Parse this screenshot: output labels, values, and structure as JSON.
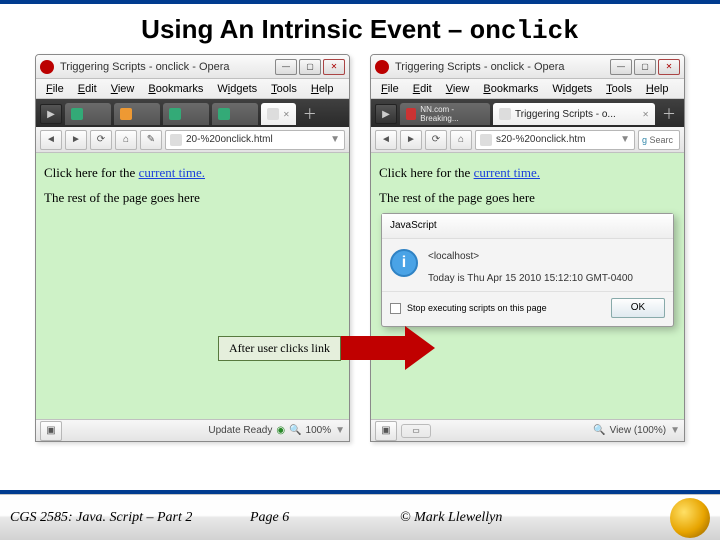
{
  "title": {
    "prefix": "Using An Intrinsic Event – ",
    "code": "onclick"
  },
  "left_window": {
    "title": "Triggering Scripts - onclick - Opera",
    "menu": [
      "File",
      "Edit",
      "View",
      "Bookmarks",
      "Widgets",
      "Tools",
      "Help"
    ],
    "address": "20-%20onclick.html",
    "page_line1_prefix": "Click here for the ",
    "page_link": "current time.",
    "page_line2": "The rest of the page goes here",
    "status_label": "Update Ready",
    "zoom": "100%"
  },
  "right_window": {
    "title": "Triggering Scripts - onclick - Opera",
    "menu": [
      "File",
      "Edit",
      "View",
      "Bookmarks",
      "Widgets",
      "Tools",
      "Help"
    ],
    "tab_label": "Triggering Scripts - o...",
    "address": "s20-%20onclick.htm",
    "search_placeholder": "Searc",
    "page_line1_prefix": "Click here for the ",
    "page_link": "current time.",
    "page_line2": "The rest of the page goes here",
    "dialog": {
      "title": "JavaScript",
      "host": "<localhost>",
      "message": "Today is Thu Apr 15 2010 15:12:10 GMT-0400",
      "checkbox_label": "Stop executing scripts on this page",
      "ok": "OK"
    },
    "status_view": "View (100%)"
  },
  "callout": "After user clicks link",
  "footer": {
    "course": "CGS 2585: Java. Script – Part 2",
    "page": "Page 6",
    "author": "© Mark Llewellyn"
  }
}
